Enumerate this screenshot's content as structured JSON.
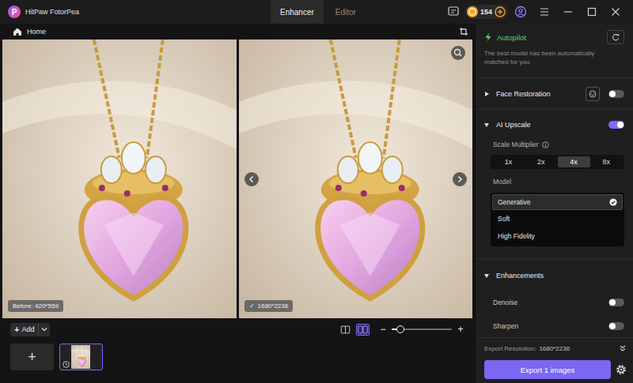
{
  "window": {
    "logo": "P",
    "title": "HitPaw FotorPea"
  },
  "tabs": [
    {
      "label": "Enhancer",
      "selected": true
    },
    {
      "label": "Editor",
      "selected": false
    }
  ],
  "credits": {
    "count": "154"
  },
  "header": {
    "home": "Home"
  },
  "preview": {
    "before": {
      "label": "Before: 420*559"
    },
    "after": {
      "check": "✓",
      "label": "1680*2236"
    }
  },
  "toolbar": {
    "add": {
      "icon": "+",
      "label": "Add"
    },
    "view_modes": [
      {
        "selected": false
      },
      {
        "selected": true
      }
    ],
    "zoom": {
      "minus": "−",
      "plus": "+",
      "level": 0.15
    }
  },
  "thumbnails": [
    {
      "kind": "add",
      "icon": "+",
      "selected": false
    },
    {
      "kind": "image",
      "selected": true
    }
  ],
  "panel": {
    "autopilot": {
      "title": "Autopilot",
      "description": "The best model has been automatically matched for you"
    },
    "face_restoration": {
      "title": "Face Restoration",
      "expanded": false,
      "on": false
    },
    "ai_upscale": {
      "title": "AI Upscale",
      "expanded": true,
      "on": true,
      "scale_label": "Scale Multiplier",
      "scales": [
        {
          "label": "1x",
          "selected": false
        },
        {
          "label": "2x",
          "selected": false
        },
        {
          "label": "4x",
          "selected": true
        },
        {
          "label": "8x",
          "selected": false
        }
      ],
      "model_label": "Model",
      "models": [
        {
          "label": "Generative",
          "selected": true
        },
        {
          "label": "Soft",
          "selected": false
        },
        {
          "label": "High Fidelity",
          "selected": false
        }
      ]
    },
    "enhancements": {
      "title": "Enhancements",
      "expanded": true,
      "items": [
        {
          "label": "Denoise",
          "on": false
        },
        {
          "label": "Sharpen",
          "on": false
        }
      ]
    }
  },
  "export": {
    "resolution_label": "Export Resolution:",
    "resolution": "1680*2236",
    "button": "Export 1 images"
  }
}
